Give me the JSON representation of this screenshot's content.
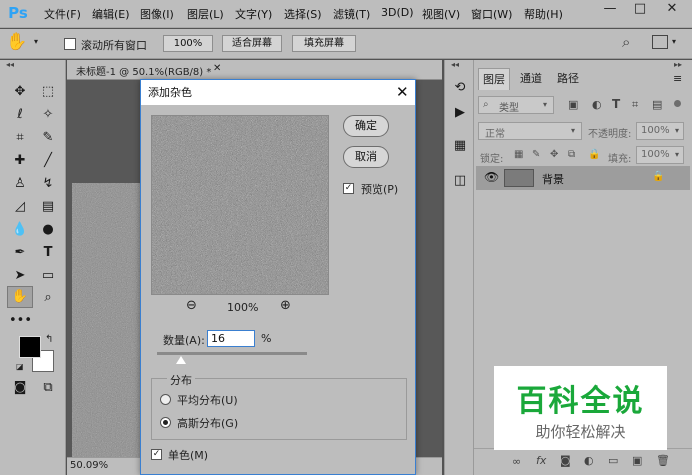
{
  "app": {
    "logo": "Ps"
  },
  "menu": [
    "文件(F)",
    "编辑(E)",
    "图像(I)",
    "图层(L)",
    "文字(Y)",
    "选择(S)",
    "滤镜(T)",
    "3D(D)",
    "视图(V)",
    "窗口(W)",
    "帮助(H)"
  ],
  "window_controls": {
    "minimize": "—",
    "maximize": "□",
    "close": "✕"
  },
  "options_bar": {
    "scroll_all_label": "滚动所有窗口",
    "zoom_100": "100%",
    "fit_screen": "适合屏幕",
    "fill_screen": "填充屏幕"
  },
  "document": {
    "tab_title": "未标题-1 @ 50.1%(RGB/8) *",
    "status_zoom": "50.09%"
  },
  "dialog": {
    "title": "添加杂色",
    "ok": "确定",
    "cancel": "取消",
    "preview_label": "预览(P)",
    "preview_checked": true,
    "preview_zoom": "100%",
    "amount_label": "数量(A):",
    "amount_value": "16",
    "amount_unit": "%",
    "amount_slider_fraction": 0.16,
    "distribution_label": "分布",
    "uniform_label": "平均分布(U)",
    "gaussian_label": "高斯分布(G)",
    "selected_distribution": "gaussian",
    "mono_label": "单色(M)",
    "mono_checked": true
  },
  "layers_panel": {
    "tabs": [
      "图层",
      "通道",
      "路径"
    ],
    "kind_filter": "类型",
    "blend_mode": "正常",
    "opacity_label": "不透明度:",
    "opacity_value": "100%",
    "lock_label": "锁定:",
    "fill_label": "填充:",
    "fill_value": "100%",
    "layers": [
      {
        "name": "背景",
        "visible": true,
        "locked": true
      }
    ]
  },
  "watermark": {
    "title": "百科全说",
    "subtitle": "助你轻松解决"
  },
  "colors": {
    "ui_gray": "#bdbdbd",
    "dialog_border": "#3a7fd0",
    "watermark_green": "#1aa83a",
    "ps_blue": "#2fa3f5"
  }
}
